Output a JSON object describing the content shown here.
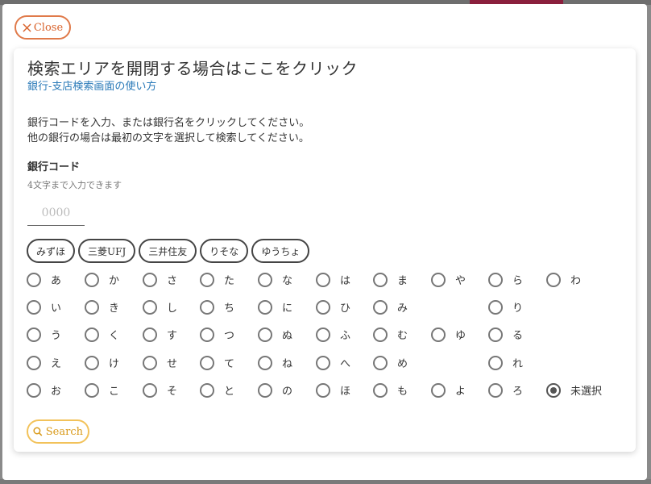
{
  "close_label": "Close",
  "title": "検索エリアを開閉する場合はここをクリック",
  "help_link": "銀行-支店検索画面の使い方",
  "instructions": [
    "銀行コードを入力、または銀行名をクリックしてください。",
    "他の銀行の場合は最初の文字を選択して検索してください。"
  ],
  "bank_code": {
    "label": "銀行コード",
    "hint": "4文字まで入力できます",
    "placeholder": "0000",
    "value": ""
  },
  "quick_banks": [
    "みずほ",
    "三菱UFJ",
    "三井住友",
    "りそな",
    "ゆうちょ"
  ],
  "kana_columns": [
    [
      "あ",
      "い",
      "う",
      "え",
      "お"
    ],
    [
      "か",
      "き",
      "く",
      "け",
      "こ"
    ],
    [
      "さ",
      "し",
      "す",
      "せ",
      "そ"
    ],
    [
      "た",
      "ち",
      "つ",
      "て",
      "と"
    ],
    [
      "な",
      "に",
      "ぬ",
      "ね",
      "の"
    ],
    [
      "は",
      "ひ",
      "ふ",
      "へ",
      "ほ"
    ],
    [
      "ま",
      "み",
      "む",
      "め",
      "も"
    ],
    [
      "や",
      "",
      "ゆ",
      "",
      "よ"
    ],
    [
      "ら",
      "り",
      "る",
      "れ",
      "ろ"
    ],
    [
      "わ",
      "",
      "",
      "",
      "未選択"
    ]
  ],
  "selected_kana": "未選択",
  "search_label": "Search",
  "colors": {
    "close_accent": "#e07a4a",
    "link": "#2a7ab8",
    "search_accent": "#f2c25a"
  },
  "icons": {
    "close": "close-icon",
    "search": "search-icon"
  }
}
